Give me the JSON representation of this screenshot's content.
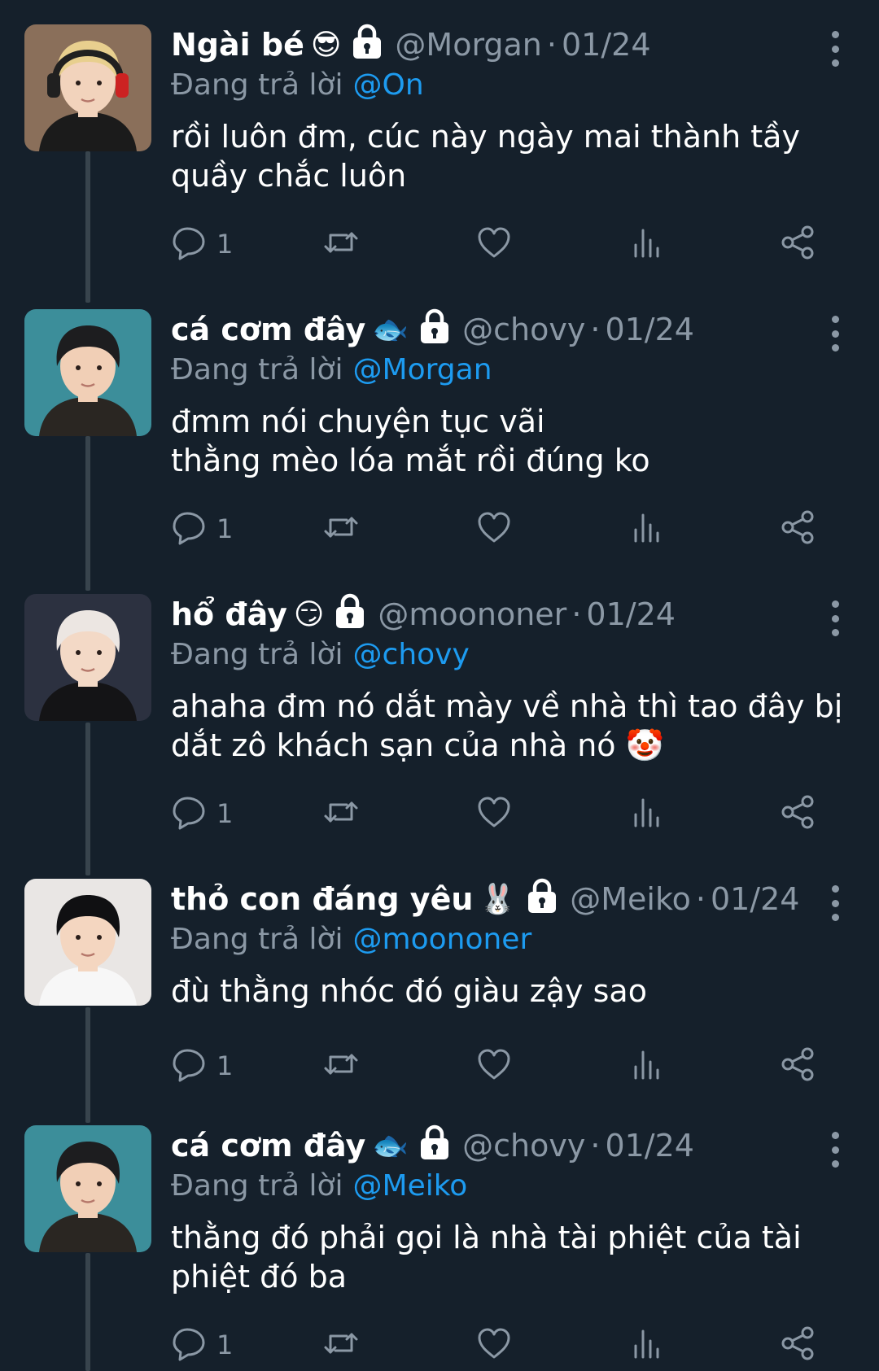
{
  "tweets": [
    {
      "display_name": "Ngài bé",
      "emoji": "😎",
      "handle": "@Morgan",
      "date": "01/24",
      "replying_label": "Đang trả lời",
      "replying_to": "@On",
      "text_lines": [
        "rồi luôn đm, cúc này ngày mai thành tầy",
        "quầy chắc luôn"
      ],
      "reply_count": "1",
      "avatar": {
        "bg": "#8a6f5a",
        "hair": "#e8cf8e",
        "skin": "#f2d3bc",
        "shirt": "#1b1b1b",
        "headset": true
      }
    },
    {
      "display_name": "cá cơm đây",
      "emoji": "🐟",
      "handle": "@chovy",
      "date": "01/24",
      "replying_label": "Đang trả lời",
      "replying_to": "@Morgan",
      "text_lines": [
        "đmm nói chuyện tục vãi",
        "thằng mèo lóa mắt rồi đúng ko"
      ],
      "reply_count": "1",
      "avatar": {
        "bg": "#3c8e9a",
        "hair": "#1d1d1f",
        "skin": "#f1cfb6",
        "shirt": "#2a2622",
        "headset": false
      }
    },
    {
      "display_name": "hổ đây",
      "emoji": "😏",
      "handle": "@moononer",
      "date": "01/24",
      "replying_label": "Đang trả lời",
      "replying_to": "@chovy",
      "text_lines": [
        "ahaha đm nó dắt mày về nhà thì tao đây bị",
        "dắt zô khách sạn của nhà nó 🤡"
      ],
      "reply_count": "1",
      "avatar": {
        "bg": "#2c3140",
        "hair": "#ece6e2",
        "skin": "#f3d9c6",
        "shirt": "#141416",
        "headset": false
      }
    },
    {
      "display_name": "thỏ con đáng yêu",
      "emoji": "🐰",
      "handle": "@Meiko",
      "date": "01/24",
      "replying_label": "Đang trả lời",
      "replying_to": "@moononer",
      "text_lines": [
        "đù thằng nhóc đó giàu zậy sao"
      ],
      "reply_count": "1",
      "avatar": {
        "bg": "#e9e6e4",
        "hair": "#101012",
        "skin": "#f4d6c0",
        "shirt": "#f7f7f7",
        "headset": false
      }
    },
    {
      "display_name": "cá cơm đây",
      "emoji": "🐟",
      "handle": "@chovy",
      "date": "01/24",
      "replying_label": "Đang trả lời",
      "replying_to": "@Meiko",
      "text_lines": [
        "thằng đó phải gọi là nhà tài phiệt của tài",
        "phiệt đó ba"
      ],
      "reply_count": "1",
      "avatar": {
        "bg": "#3c8e9a",
        "hair": "#1d1d1f",
        "skin": "#f1cfb6",
        "shirt": "#2a2622",
        "headset": false
      }
    }
  ],
  "colors": {
    "background": "#15202b",
    "secondary_text": "#8b98a5",
    "accent": "#1d9bf0",
    "thread_line": "#38444d"
  },
  "icons": [
    "lock-icon",
    "more-options-icon",
    "reply-icon",
    "retweet-icon",
    "like-icon",
    "views-icon",
    "share-icon"
  ]
}
